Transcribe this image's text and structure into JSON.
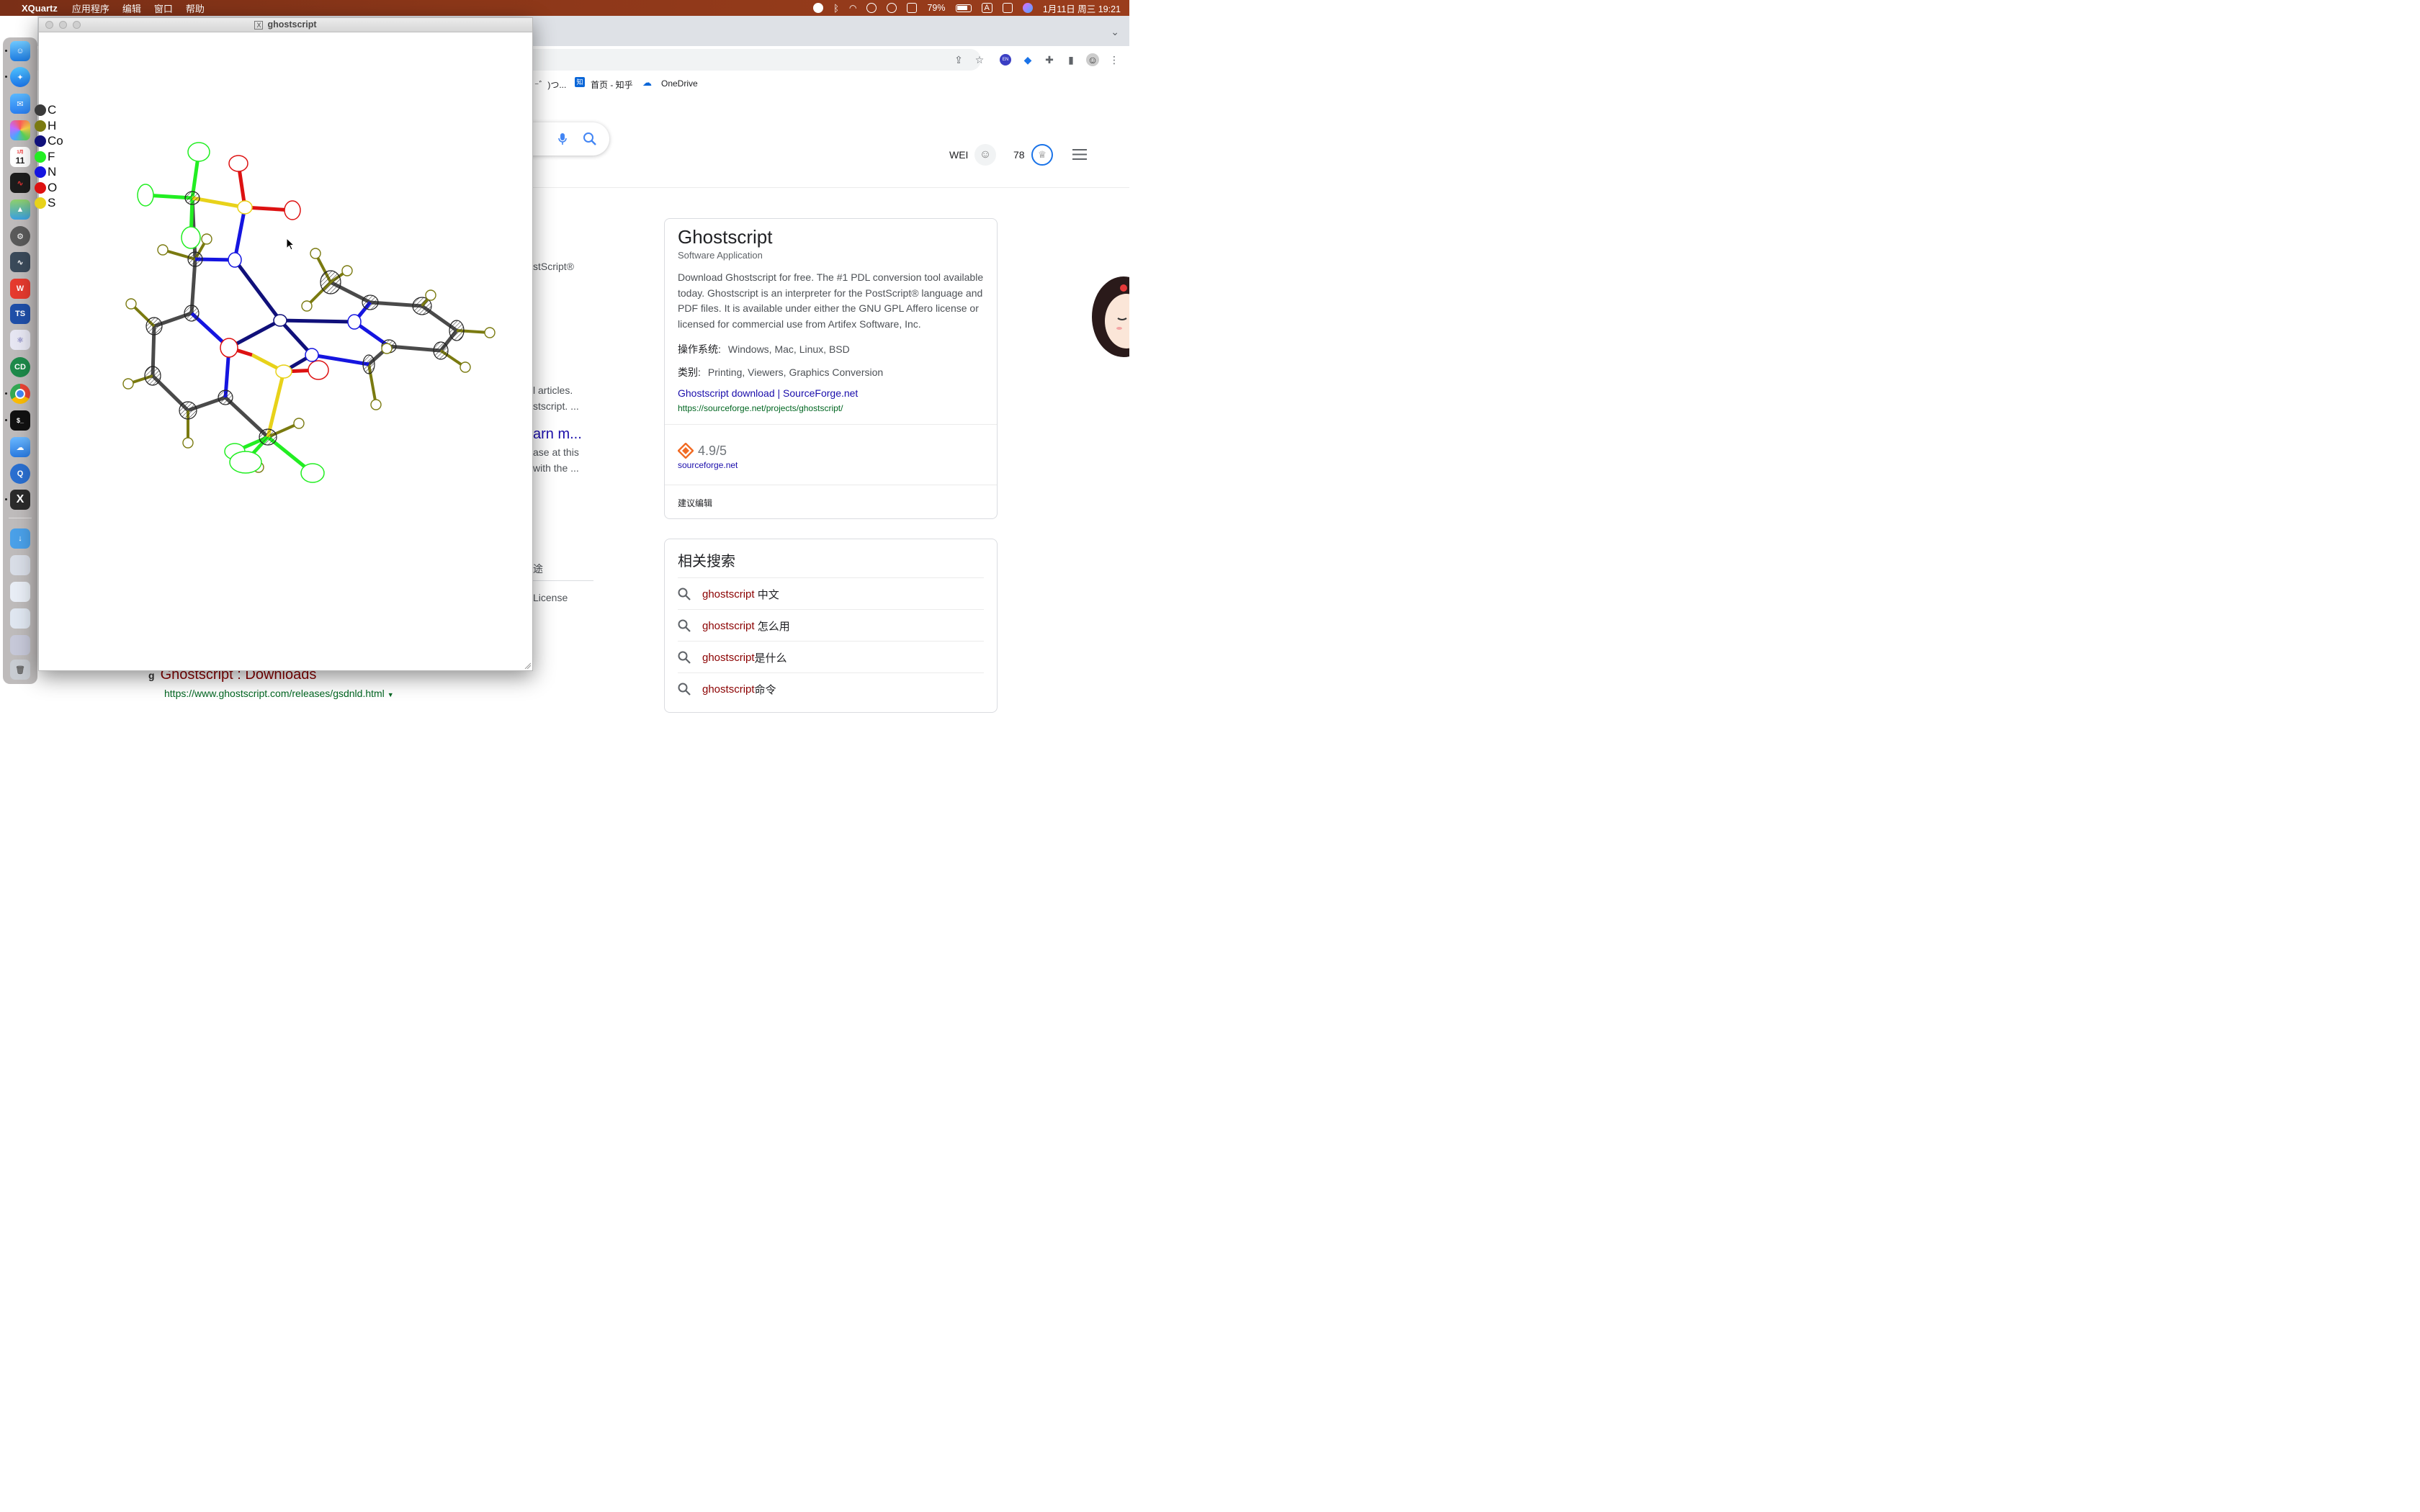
{
  "menubar": {
    "app_name": "XQuartz",
    "menus": [
      "应用程序",
      "编辑",
      "窗口",
      "帮助"
    ],
    "battery": "79%",
    "input_method": "A",
    "datetime": "1月11日 周三  19:21"
  },
  "dock": {
    "calendar_day": "11",
    "calendar_month": "1月",
    "ts_label": "TS",
    "cd_label": "CD"
  },
  "chrome": {
    "bookmarks": [
      {
        "label": "⁻゛)つ..."
      },
      {
        "label": "首页 - 知乎"
      },
      {
        "label": "OneDrive"
      }
    ],
    "ext_en": "EN",
    "user_name": "WEI",
    "points": "78",
    "partial_texts": {
      "p1": "stScript®",
      "p2": "l articles.",
      "p3": "stscript. ...",
      "p4": "arn m...",
      "p5": "ase at this",
      "p6": "with the ...",
      "p7": "途",
      "p8": "License"
    }
  },
  "knowledge_panel": {
    "title": "Ghostscript",
    "subtitle": "Software Application",
    "description": "Download Ghostscript for free. The #1 PDL conversion tool available today. Ghostscript is an interpreter for the PostScript® language and PDF files. It is available under either the GNU GPL Affero license or licensed for commercial use from Artifex Software, Inc.",
    "os_label": "操作系统:",
    "os_value": "Windows, Mac, Linux, BSD",
    "category_label": "类别:",
    "category_value": "Printing, Viewers, Graphics Conversion",
    "link_title": "Ghostscript download | SourceForge.net",
    "link_url": "https://sourceforge.net/projects/ghostscript/",
    "rating": "4.9/5",
    "rating_source": "sourceforge.net",
    "suggest_edit": "建议编辑"
  },
  "related_searches": {
    "heading": "相关搜索",
    "items": [
      {
        "query": "ghostscript",
        "suffix": " 中文"
      },
      {
        "query": "ghostscript",
        "suffix": " 怎么用"
      },
      {
        "query": "ghostscript",
        "suffix": "是什么"
      },
      {
        "query": "ghostscript",
        "suffix": "命令"
      }
    ]
  },
  "bottom_result": {
    "title": "Ghostscript : Downloads",
    "url": "https://www.ghostscript.com/releases/gsdnld.html"
  },
  "xquartz_window": {
    "title": "ghostscript",
    "x_badge": "X",
    "legend": [
      {
        "symbol": "C",
        "color": "#3a3a3a"
      },
      {
        "symbol": "H",
        "color": "#7a7a10"
      },
      {
        "symbol": "Co",
        "color": "#10107a"
      },
      {
        "symbol": "F",
        "color": "#22ee22"
      },
      {
        "symbol": "N",
        "color": "#1515e0"
      },
      {
        "symbol": "O",
        "color": "#dd1111"
      },
      {
        "symbol": "S",
        "color": "#e8d21a"
      }
    ]
  }
}
